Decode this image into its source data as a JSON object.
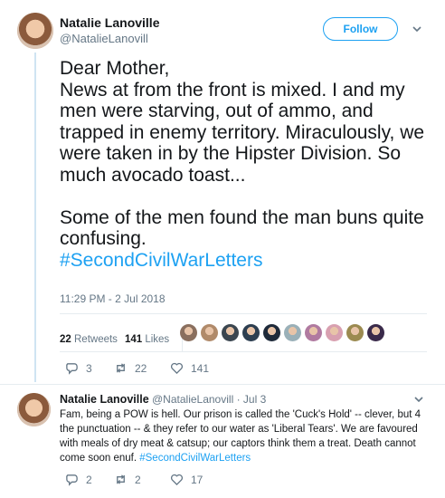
{
  "main_tweet": {
    "author_name": "Natalie Lanoville",
    "author_handle": "@NatalieLanovill",
    "follow_label": "Follow",
    "text_para1": "Dear Mother,\nNews at from the front is mixed. I and my men were starving, out of ammo, and trapped in enemy territory. Miraculously, we were  taken in by the Hipster Division. So much avocado toast...",
    "text_para2": "Some of the men found the man buns quite confusing.",
    "hashtag": "#SecondCivilWarLetters",
    "timestamp": "11:29 PM - 2 Jul 2018",
    "retweets_count": "22",
    "retweets_label": "Retweets",
    "likes_count": "141",
    "likes_label": "Likes",
    "liker_colors": [
      "#8a6f5e",
      "#b08a6a",
      "#3b4650",
      "#2c3e50",
      "#1e2a3a",
      "#9ab0b8",
      "#b07aa0",
      "#d8a0b0",
      "#9b8a50",
      "#3a2a4a"
    ],
    "reply_count": "3",
    "retweet_action_count": "22",
    "like_action_count": "141"
  },
  "reply_tweet": {
    "author_name": "Natalie Lanoville",
    "author_handle": "@NatalieLanovill",
    "date": "· Jul 3",
    "text": "Fam, being a POW is hell. Our prison is called the 'Cuck's Hold' -- clever, but 4 the punctuation -- & they refer to our water as 'Liberal Tears'. We are favoured with meals of dry meat & catsup; our captors think them a treat. Death cannot come soon enuf.",
    "hashtag": "#SecondCivilWarLetters",
    "reply_count": "2",
    "retweet_count": "2",
    "like_count": "17"
  },
  "colors": {
    "accent": "#1da1f2",
    "muted": "#657786",
    "text": "#14171a",
    "divider": "#e6ecf0"
  }
}
